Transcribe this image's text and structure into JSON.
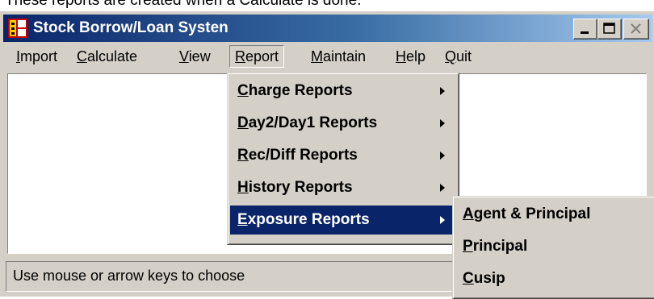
{
  "caption": "These reports are created when a Calculate is done.",
  "window": {
    "title": "Stock Borrow/Loan Systen",
    "icon": "app-logo-icon",
    "controls": [
      "minimize",
      "maximize",
      "close"
    ]
  },
  "menubar": {
    "items": [
      {
        "pre": "",
        "key": "I",
        "post": "mport"
      },
      {
        "pre": "",
        "key": "C",
        "post": "alculate"
      },
      {
        "pre": "",
        "key": "V",
        "post": "iew"
      },
      {
        "pre": "",
        "key": "R",
        "post": "eport"
      },
      {
        "pre": "",
        "key": "M",
        "post": "aintain"
      },
      {
        "pre": "",
        "key": "H",
        "post": "elp"
      },
      {
        "pre": "",
        "key": "Q",
        "post": "uit"
      }
    ]
  },
  "report_menu": {
    "items": [
      {
        "key": "C",
        "rest": "harge Reports",
        "submenu": true
      },
      {
        "key": "D",
        "rest": "ay2/Day1 Reports",
        "submenu": true
      },
      {
        "key": "R",
        "rest": "ec/Diff Reports",
        "submenu": true
      },
      {
        "key": "H",
        "rest": "istory Reports",
        "submenu": true
      },
      {
        "key": "E",
        "rest": "xposure Reports",
        "submenu": true,
        "highlighted": true
      }
    ]
  },
  "exposure_submenu": {
    "items": [
      {
        "key": "A",
        "rest": "gent & Principal"
      },
      {
        "key": "P",
        "rest": "rincipal"
      },
      {
        "key": "C",
        "rest": "usip"
      }
    ]
  },
  "status": {
    "text": "Use mouse or arrow keys to choose"
  },
  "colors": {
    "title_gradient_start": "#0a246a",
    "title_gradient_end": "#a6caf0",
    "face": "#d4d0c8",
    "highlight": "#0a246a"
  }
}
